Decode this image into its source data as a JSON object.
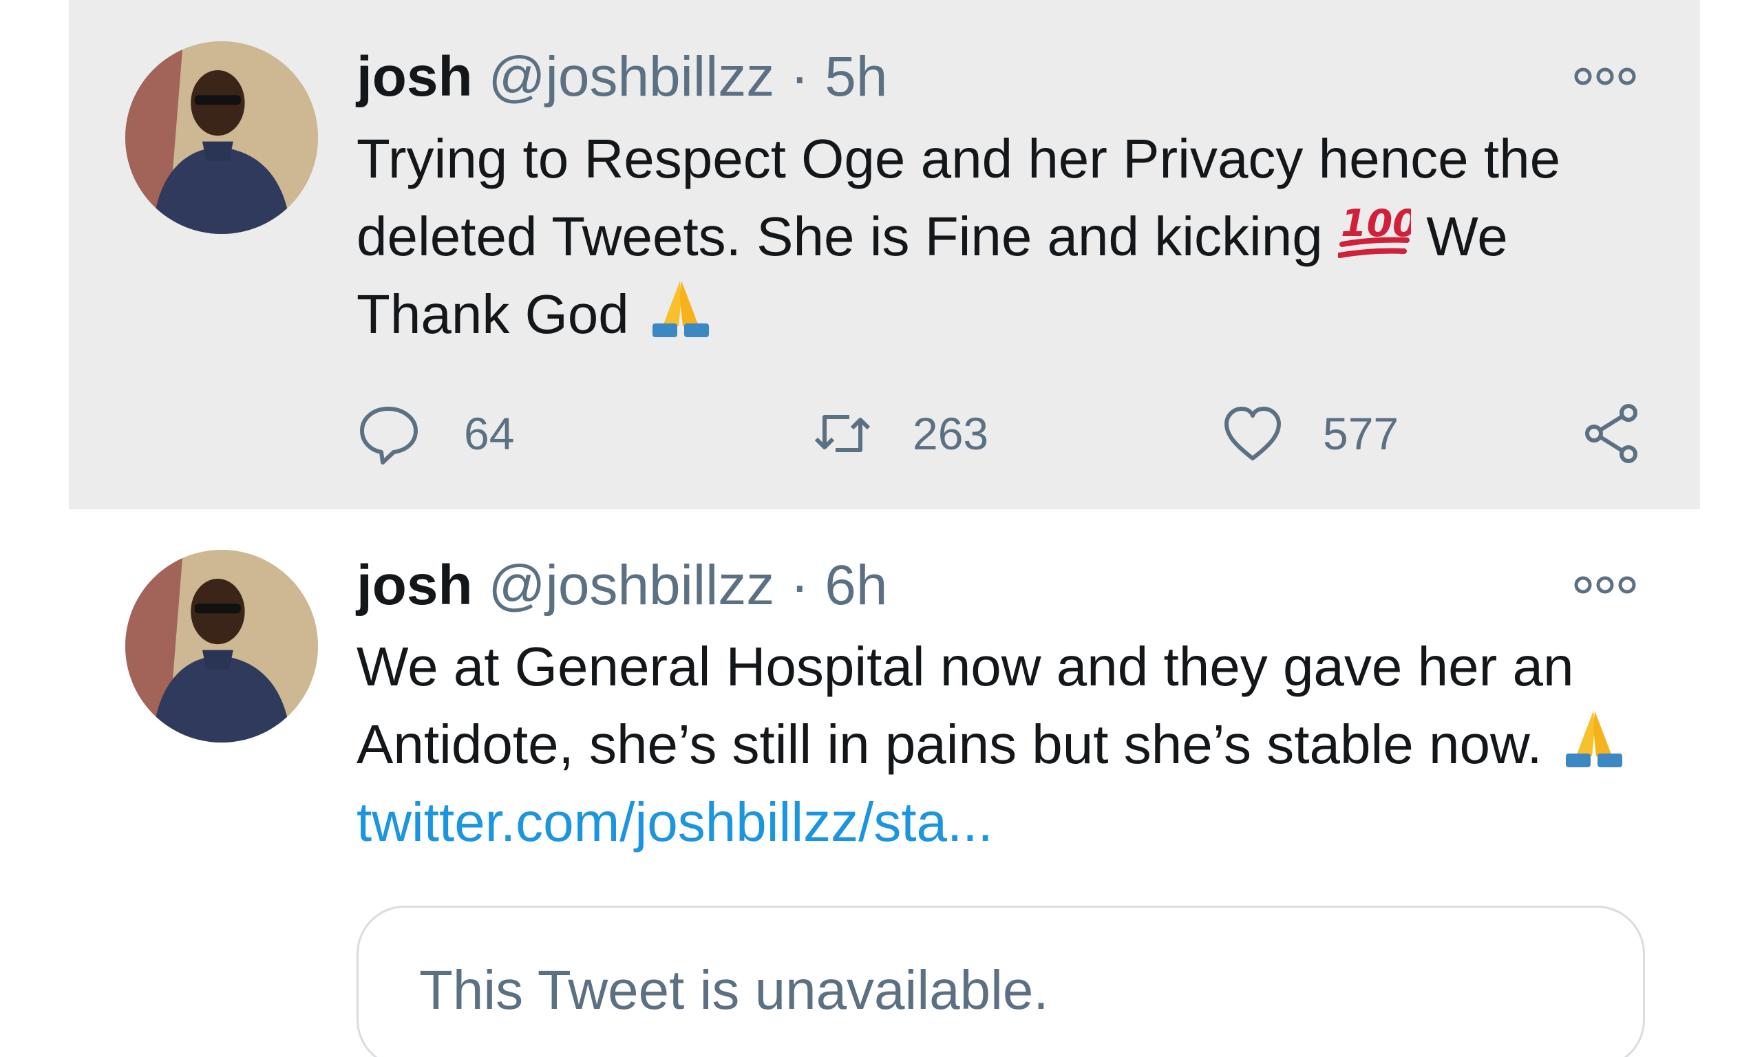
{
  "tweets": [
    {
      "author_name": "josh",
      "handle": "@joshbillzz",
      "separator": "·",
      "time": "5h",
      "text_part1": "Trying to Respect Oge and her Privacy hence the deleted Tweets. She is Fine and kicking ",
      "emoji_1": "hundred-points-emoji",
      "text_part2": " We Thank God ",
      "emoji_2": "folded-hands-emoji",
      "actions": {
        "replies": "64",
        "retweets": "263",
        "likes": "577"
      }
    },
    {
      "author_name": "josh",
      "handle": "@joshbillzz",
      "separator": "·",
      "time": "6h",
      "text_part1": "We at General Hospital now and they gave her an Antidote, she’s still in pains but she’s stable now. ",
      "emoji_1": "folded-hands-emoji",
      "link_text": "twitter.com/joshbillzz/sta...",
      "quote_text": "This Tweet is unavailable."
    }
  ],
  "icons": {
    "reply": "speech-bubble-icon",
    "retweet": "retweet-arrows-icon",
    "like": "heart-icon",
    "share": "share-icon",
    "more": "more-dots-icon"
  },
  "colors": {
    "highlight_background": "#ececec",
    "secondary_text": "#5b7083",
    "link": "#1b95e0",
    "hundred_emoji": "#d0213a",
    "folded_hands_emoji": "#f8c12c"
  }
}
